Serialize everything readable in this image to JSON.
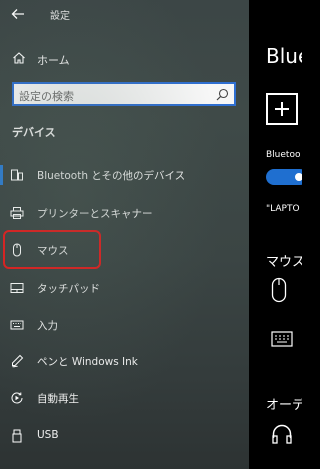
{
  "app": {
    "title": "設定"
  },
  "sidebar": {
    "home_label": "ホーム",
    "search_placeholder": "設定の検索",
    "section_title": "デバイス",
    "items": [
      {
        "label": "Bluetooth とその他のデバイス",
        "icon": "bluetooth-devices-icon",
        "selected": true
      },
      {
        "label": "プリンターとスキャナー",
        "icon": "printer-icon",
        "selected": false
      },
      {
        "label": "マウス",
        "icon": "mouse-icon",
        "selected": false,
        "highlighted": true
      },
      {
        "label": "タッチパッド",
        "icon": "touchpad-icon",
        "selected": false
      },
      {
        "label": "入力",
        "icon": "keyboard-icon",
        "selected": false
      },
      {
        "label": "ペンと Windows Ink",
        "icon": "pen-icon",
        "selected": false
      },
      {
        "label": "自動再生",
        "icon": "autoplay-icon",
        "selected": false
      },
      {
        "label": "USB",
        "icon": "usb-icon",
        "selected": false
      }
    ]
  },
  "main": {
    "title": "Blue",
    "bluetooth_label": "Bluetoo",
    "bluetooth_on": true,
    "device_name": "\"LAPTO",
    "mouse_section": "マウス",
    "audio_section": "オーデ"
  },
  "colors": {
    "accent": "#2d7dd2",
    "highlight": "#e51b1b",
    "toggle": "#1f6fd0"
  }
}
